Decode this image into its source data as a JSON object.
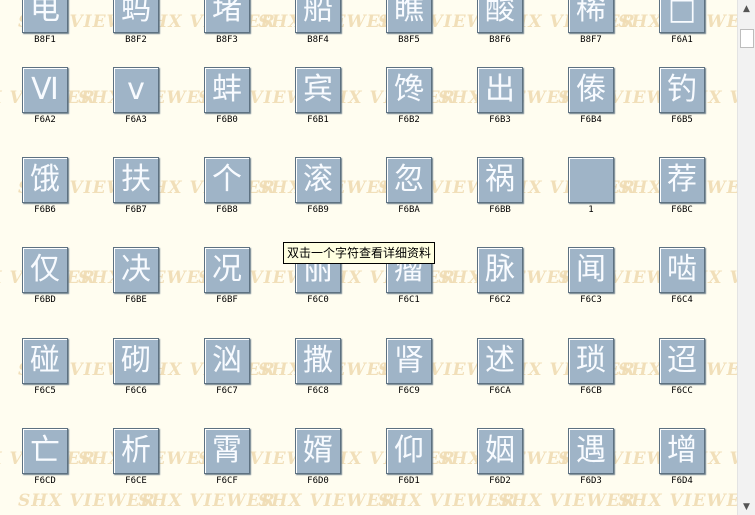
{
  "tooltip": "双击一个字符查看详细资料",
  "watermark_text": "SHX VIEWER",
  "icons": {
    "scroll_up": "scroll-up-arrow-icon",
    "scroll_down": "scroll-down-arrow-icon"
  },
  "colors": {
    "tile": "#9fb4c7",
    "glyph": "#f8fbff",
    "background": "#fffdf0",
    "watermark": "#f0dcb4"
  },
  "rows": [
    {
      "cells": [
        {
          "code": "B8F1",
          "glyph": "电"
        },
        {
          "code": "B8F2",
          "glyph": "蚂"
        },
        {
          "code": "B8F3",
          "glyph": "堵"
        },
        {
          "code": "B8F4",
          "glyph": "船"
        },
        {
          "code": "B8F5",
          "glyph": "瞧"
        },
        {
          "code": "B8F6",
          "glyph": "酸"
        },
        {
          "code": "B8F7",
          "glyph": "稀"
        },
        {
          "code": "F6A1",
          "glyph": "□"
        }
      ]
    },
    {
      "cells": [
        {
          "code": "F6A2",
          "glyph": "Ⅵ"
        },
        {
          "code": "F6A3",
          "glyph": "ⅴ"
        },
        {
          "code": "F6B0",
          "glyph": "蚌"
        },
        {
          "code": "F6B1",
          "glyph": "宾"
        },
        {
          "code": "F6B2",
          "glyph": "馋"
        },
        {
          "code": "F6B3",
          "glyph": "出"
        },
        {
          "code": "F6B4",
          "glyph": "傣"
        },
        {
          "code": "F6B5",
          "glyph": "钓"
        }
      ]
    },
    {
      "cells": [
        {
          "code": "F6B6",
          "glyph": "饿"
        },
        {
          "code": "F6B7",
          "glyph": "扶"
        },
        {
          "code": "F6B8",
          "glyph": "个"
        },
        {
          "code": "F6B9",
          "glyph": "滚"
        },
        {
          "code": "F6BA",
          "glyph": "忽"
        },
        {
          "code": "F6BB",
          "glyph": "祸"
        },
        {
          "code": "1",
          "glyph": ""
        },
        {
          "code": "F6BC",
          "glyph": "荐"
        }
      ]
    },
    {
      "cells": [
        {
          "code": "F6BD",
          "glyph": "仅"
        },
        {
          "code": "F6BE",
          "glyph": "决"
        },
        {
          "code": "F6BF",
          "glyph": "况"
        },
        {
          "code": "F6C0",
          "glyph": "丽"
        },
        {
          "code": "F6C1",
          "glyph": "瘤"
        },
        {
          "code": "F6C2",
          "glyph": "脉"
        },
        {
          "code": "F6C3",
          "glyph": "闻"
        },
        {
          "code": "F6C4",
          "glyph": "啮"
        }
      ]
    },
    {
      "cells": [
        {
          "code": "F6C5",
          "glyph": "碰"
        },
        {
          "code": "F6C6",
          "glyph": "砌"
        },
        {
          "code": "F6C7",
          "glyph": "汹"
        },
        {
          "code": "F6C8",
          "glyph": "撒"
        },
        {
          "code": "F6C9",
          "glyph": "肾"
        },
        {
          "code": "F6CA",
          "glyph": "述"
        },
        {
          "code": "F6CB",
          "glyph": "琐"
        },
        {
          "code": "F6CC",
          "glyph": "迢"
        }
      ]
    },
    {
      "cells": [
        {
          "code": "F6CD",
          "glyph": "亡"
        },
        {
          "code": "F6CE",
          "glyph": "析"
        },
        {
          "code": "F6CF",
          "glyph": "霄"
        },
        {
          "code": "F6D0",
          "glyph": "婿"
        },
        {
          "code": "F6D1",
          "glyph": "仰"
        },
        {
          "code": "F6D2",
          "glyph": "姻"
        },
        {
          "code": "F6D3",
          "glyph": "遇"
        },
        {
          "code": "F6D4",
          "glyph": "增"
        }
      ]
    }
  ]
}
